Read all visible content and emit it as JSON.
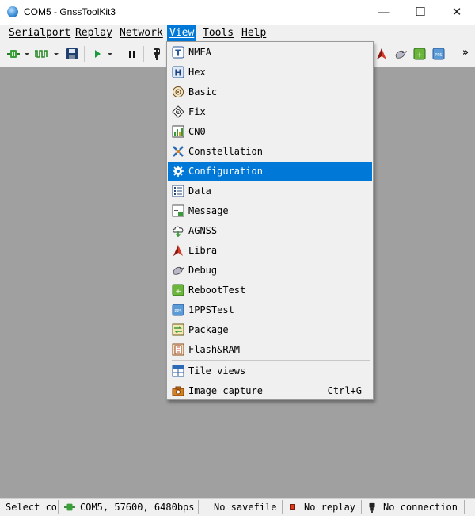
{
  "window": {
    "title": "COM5 - GnssToolKit3"
  },
  "window_controls": {
    "minimize": "—",
    "maximize": "☐",
    "close": "✕"
  },
  "menubar": {
    "items": [
      "Serialport",
      "Replay",
      "Network",
      "View",
      "Tools",
      "Help"
    ],
    "active": "View"
  },
  "toolbar": {
    "overflow": "»"
  },
  "view_menu": {
    "items": [
      {
        "label": "NMEA",
        "icon": "nmea-text-icon"
      },
      {
        "label": "Hex",
        "icon": "hex-icon"
      },
      {
        "label": "Basic",
        "icon": "basic-gauge-icon"
      },
      {
        "label": "Fix",
        "icon": "fix-target-icon"
      },
      {
        "label": "CN0",
        "icon": "cn0-bar-chart-icon"
      },
      {
        "label": "Constellation",
        "icon": "satellite-icon"
      },
      {
        "label": "Configuration",
        "icon": "configuration-gear-icon",
        "highlighted": true
      },
      {
        "label": "Data",
        "icon": "data-table-icon"
      },
      {
        "label": "Message",
        "icon": "message-icon"
      },
      {
        "label": "AGNSS",
        "icon": "agnss-cloud-icon"
      },
      {
        "label": "Libra",
        "icon": "libra-arrow-icon"
      },
      {
        "label": "Debug",
        "icon": "debug-bird-icon"
      },
      {
        "label": "RebootTest",
        "icon": "reboot-test-icon"
      },
      {
        "label": "1PPSTest",
        "icon": "pps-icon"
      },
      {
        "label": "Package",
        "icon": "package-icon"
      },
      {
        "label": "Flash&RAM",
        "icon": "flash-ram-icon"
      }
    ],
    "extra_items": [
      {
        "label": "Tile views",
        "icon": "tile-views-icon",
        "shortcut": ""
      },
      {
        "label": "Image capture",
        "icon": "image-capture-icon",
        "shortcut": "Ctrl+G"
      }
    ]
  },
  "statusbar": {
    "select": "Select co",
    "port": "COM5, 57600, 6480bps",
    "savefile": "No savefile",
    "replay": "No replay",
    "connection": "No connection"
  },
  "colors": {
    "accent": "#0078d7",
    "workspace": "#a0a0a0",
    "chrome": "#f0f0f0"
  }
}
